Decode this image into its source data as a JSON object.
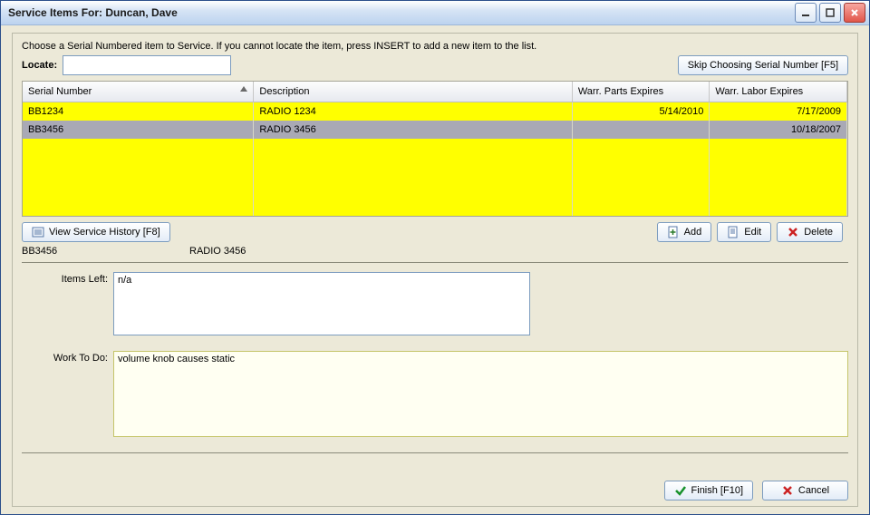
{
  "window": {
    "title": "Service Items For: Duncan, Dave"
  },
  "instructions": "Choose a Serial Numbered item to Service.  If you cannot locate the item, press INSERT to add a new item to the list.",
  "locate": {
    "label": "Locate:",
    "value": ""
  },
  "skip_button": "Skip Choosing Serial Number [F5]",
  "columns": {
    "serial": "Serial Number",
    "description": "Description",
    "parts": "Warr. Parts Expires",
    "labor": "Warr. Labor Expires"
  },
  "rows": [
    {
      "serial": "BB1234",
      "description": "RADIO 1234",
      "parts": "5/14/2010",
      "labor": "7/17/2009",
      "style": "yellow"
    },
    {
      "serial": "BB3456",
      "description": "RADIO 3456",
      "parts": "",
      "labor": "10/18/2007",
      "style": "sel"
    }
  ],
  "buttons": {
    "history": "View Service History [F8]",
    "add": "Add",
    "edit": "Edit",
    "delete": "Delete",
    "finish": "Finish [F10]",
    "cancel": "Cancel"
  },
  "selected": {
    "serial": "BB3456",
    "description": "RADIO 3456"
  },
  "fields": {
    "items_left": {
      "label": "Items Left:",
      "value": "n/a"
    },
    "work_to_do": {
      "label": "Work To Do:",
      "value": "volume knob causes static"
    }
  }
}
